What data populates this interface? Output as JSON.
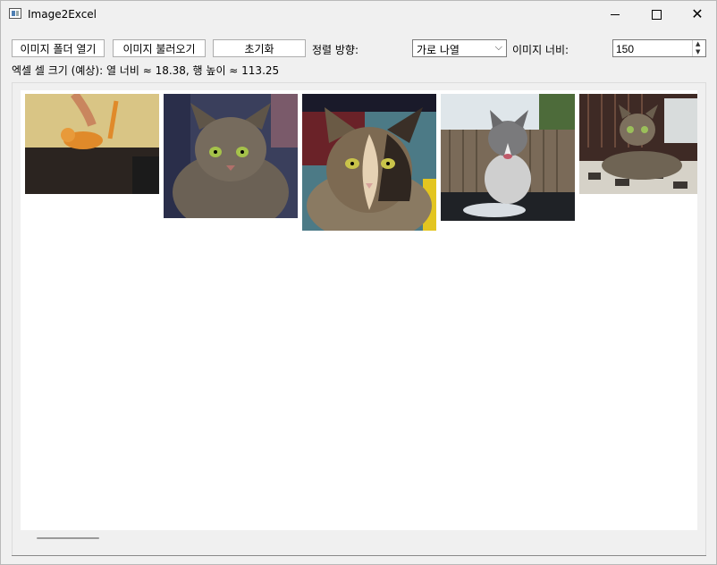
{
  "window": {
    "title": "Image2Excel"
  },
  "toolbar": {
    "open_folder_label": "이미지 폴더 열기",
    "load_images_label": "이미지 불러오기",
    "reset_label": "초기화",
    "sort_direction_label": "정렬 방향:",
    "sort_direction_value": "가로 나열",
    "image_width_label": "이미지 너비:",
    "image_width_value": "150"
  },
  "info": {
    "cell_size_text": "엑셀 셀 크기 (예상): 열 너비 ≈ 18.38, 행 높이 ≈ 113.25"
  },
  "images": [
    {
      "name": "orange-kitten-on-table"
    },
    {
      "name": "tabby-cat"
    },
    {
      "name": "calico-cat"
    },
    {
      "name": "grey-white-kitten-outdoors"
    },
    {
      "name": "tabby-kitten-on-blanket"
    }
  ]
}
